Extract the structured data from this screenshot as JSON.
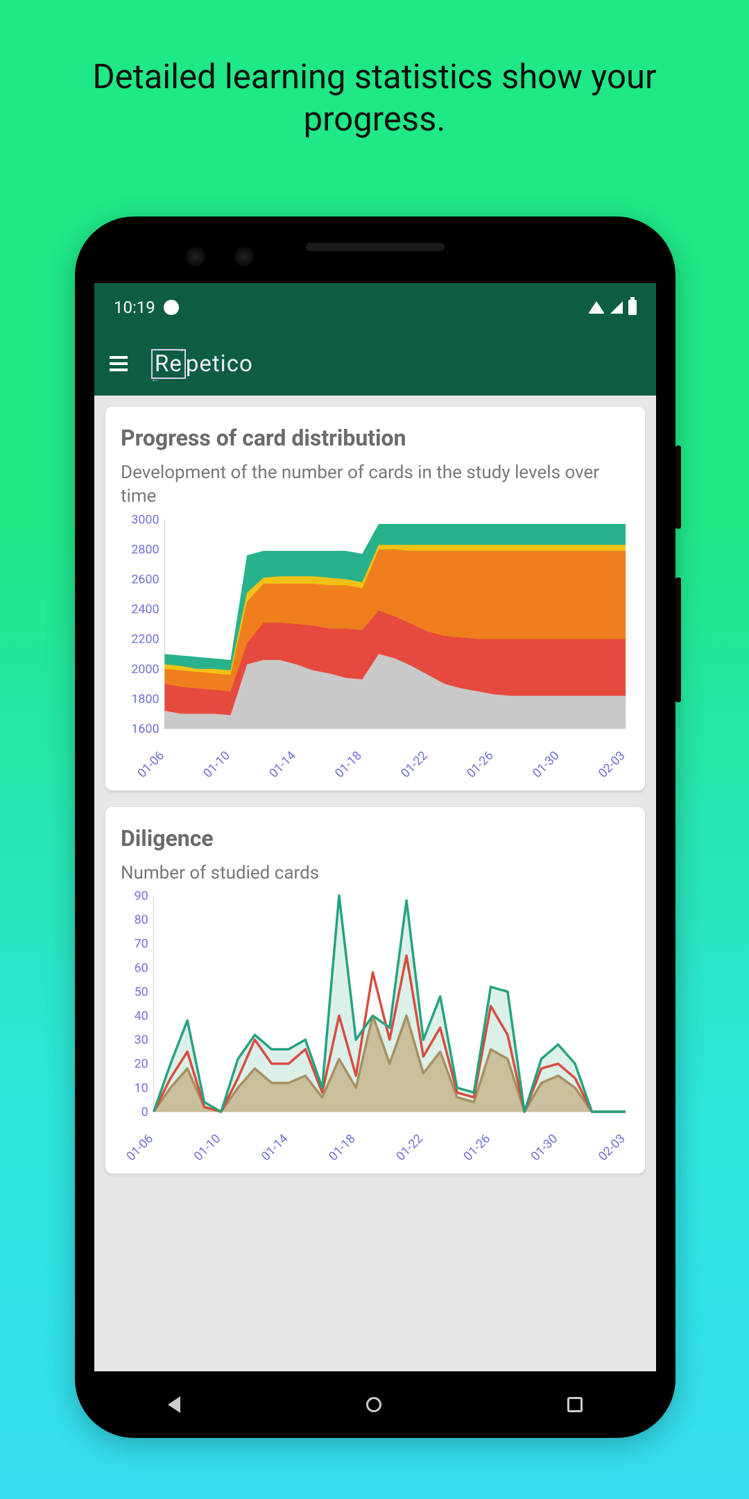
{
  "promo": {
    "title": "Detailed learning statistics show your progress."
  },
  "statusbar": {
    "time": "10:19"
  },
  "appbar": {
    "brand_left": "Re",
    "brand_right": "petico"
  },
  "card1": {
    "title": "Progress of card distribution",
    "subtitle": "Development of the number of cards in the study levels over time"
  },
  "card2": {
    "title": "Diligence",
    "subtitle": "Number of studied cards"
  },
  "chart_data": [
    {
      "type": "area",
      "title": "Progress of card distribution",
      "subtitle": "Development of the number of cards in the study levels over time",
      "xlabel": "",
      "ylabel": "",
      "ylim": [
        1600,
        3000
      ],
      "yticks": [
        1600,
        1800,
        2000,
        2200,
        2400,
        2600,
        2800,
        3000
      ],
      "categories": [
        "01-06",
        "01-07",
        "01-08",
        "01-09",
        "01-10",
        "01-11",
        "01-12",
        "01-13",
        "01-14",
        "01-15",
        "01-16",
        "01-17",
        "01-18",
        "01-19",
        "01-20",
        "01-21",
        "01-22",
        "01-23",
        "01-24",
        "01-25",
        "01-26",
        "01-27",
        "01-28",
        "01-29",
        "01-30",
        "01-31",
        "02-01",
        "02-02",
        "02-03"
      ],
      "xticks": [
        "01-06",
        "01-10",
        "01-14",
        "01-18",
        "01-22",
        "01-26",
        "01-30",
        "02-03"
      ],
      "series": [
        {
          "name": "level-grey",
          "color": "#c9c9c9",
          "values": [
            1720,
            1700,
            1700,
            1700,
            1690,
            2030,
            2060,
            2060,
            2030,
            1990,
            1970,
            1940,
            1930,
            2100,
            2070,
            2020,
            1960,
            1900,
            1870,
            1850,
            1830,
            1820,
            1820,
            1820,
            1820,
            1820,
            1820,
            1820,
            1820
          ]
        },
        {
          "name": "level-red",
          "color": "#e64a3e",
          "values": [
            1900,
            1880,
            1870,
            1860,
            1850,
            2170,
            2310,
            2310,
            2300,
            2290,
            2270,
            2270,
            2260,
            2390,
            2350,
            2300,
            2250,
            2220,
            2210,
            2200,
            2200,
            2200,
            2200,
            2200,
            2200,
            2200,
            2200,
            2200,
            2200
          ]
        },
        {
          "name": "level-orange",
          "color": "#ef7f1c",
          "values": [
            2000,
            1990,
            1980,
            1970,
            1960,
            2450,
            2570,
            2570,
            2570,
            2570,
            2560,
            2560,
            2540,
            2800,
            2800,
            2790,
            2790,
            2790,
            2790,
            2790,
            2790,
            2790,
            2790,
            2790,
            2790,
            2790,
            2790,
            2790,
            2790
          ]
        },
        {
          "name": "level-yellow",
          "color": "#f3c214",
          "values": [
            2030,
            2020,
            2000,
            2000,
            1990,
            2510,
            2610,
            2620,
            2620,
            2620,
            2610,
            2600,
            2580,
            2830,
            2830,
            2830,
            2830,
            2830,
            2830,
            2830,
            2830,
            2830,
            2830,
            2830,
            2830,
            2830,
            2830,
            2830,
            2830
          ]
        },
        {
          "name": "level-teal",
          "color": "#28b28b",
          "values": [
            2100,
            2090,
            2080,
            2070,
            2060,
            2760,
            2790,
            2790,
            2790,
            2790,
            2790,
            2790,
            2770,
            2970,
            2970,
            2970,
            2970,
            2970,
            2970,
            2970,
            2970,
            2970,
            2970,
            2970,
            2970,
            2970,
            2970,
            2970,
            2970
          ]
        }
      ]
    },
    {
      "type": "line",
      "title": "Diligence",
      "subtitle": "Number of studied cards",
      "xlabel": "",
      "ylabel": "",
      "ylim": [
        0,
        90
      ],
      "yticks": [
        0,
        10,
        20,
        30,
        40,
        50,
        60,
        70,
        80,
        90
      ],
      "categories": [
        "01-06",
        "01-07",
        "01-08",
        "01-09",
        "01-10",
        "01-11",
        "01-12",
        "01-13",
        "01-14",
        "01-15",
        "01-16",
        "01-17",
        "01-18",
        "01-19",
        "01-20",
        "01-21",
        "01-22",
        "01-23",
        "01-24",
        "01-25",
        "01-26",
        "01-27",
        "01-28",
        "01-29",
        "01-30",
        "01-31",
        "02-01",
        "02-02",
        "02-03"
      ],
      "xticks": [
        "01-06",
        "01-10",
        "01-14",
        "01-18",
        "01-22",
        "01-26",
        "01-30",
        "02-03"
      ],
      "series": [
        {
          "name": "series-brown",
          "color": "#a79060",
          "fill": "#c7b68e",
          "values": [
            0,
            10,
            18,
            2,
            0,
            10,
            18,
            12,
            12,
            15,
            6,
            22,
            10,
            40,
            20,
            40,
            16,
            25,
            6,
            4,
            26,
            22,
            0,
            12,
            15,
            10,
            0,
            0,
            0
          ]
        },
        {
          "name": "series-red",
          "color": "#d84c3e",
          "fill": "none",
          "values": [
            0,
            14,
            25,
            2,
            0,
            14,
            30,
            20,
            20,
            26,
            8,
            40,
            15,
            58,
            30,
            65,
            23,
            35,
            8,
            6,
            44,
            32,
            0,
            18,
            20,
            14,
            0,
            0,
            0
          ]
        },
        {
          "name": "series-teal",
          "color": "#24a281",
          "fill": "#bfe4d8",
          "values": [
            0,
            20,
            38,
            4,
            0,
            22,
            32,
            26,
            26,
            30,
            10,
            90,
            30,
            40,
            35,
            88,
            30,
            48,
            10,
            8,
            52,
            50,
            0,
            22,
            28,
            20,
            0,
            0,
            0
          ]
        }
      ]
    }
  ]
}
